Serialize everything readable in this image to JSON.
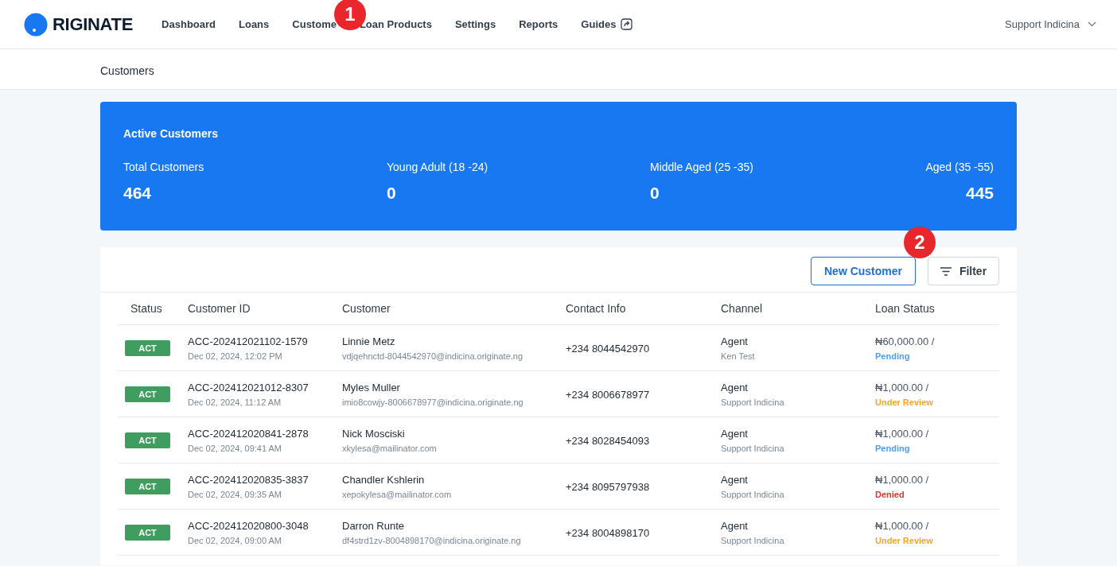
{
  "header": {
    "logo_text": "RIGINATE",
    "nav": [
      {
        "label": "Dashboard",
        "external": false
      },
      {
        "label": "Loans",
        "external": false
      },
      {
        "label": "Custome",
        "external": false
      },
      {
        "label": "Loan Products",
        "external": false
      },
      {
        "label": "Settings",
        "external": false
      },
      {
        "label": "Reports",
        "external": false
      },
      {
        "label": "Guides",
        "external": true
      }
    ],
    "user": "Support Indicina"
  },
  "breadcrumb": "Customers",
  "summary": {
    "title": "Active Customers",
    "stats": [
      {
        "label": "Total Customers",
        "value": "464"
      },
      {
        "label": "Young Adult (18 -24)",
        "value": "0"
      },
      {
        "label": "Middle Aged (25 -35)",
        "value": "0"
      },
      {
        "label": "Aged (35 -55)",
        "value": "445"
      }
    ]
  },
  "toolbar": {
    "new_button": "New Customer",
    "filter_button": "Filter"
  },
  "table": {
    "columns": [
      "Status",
      "Customer ID",
      "Customer",
      "Contact Info",
      "Channel",
      "Loan Status"
    ],
    "rows": [
      {
        "status": "ACT",
        "id": "ACC-202412021102-1579",
        "date": "Dec 02, 2024, 12:02 PM",
        "name": "Linnie Metz",
        "email": "vdjqehnctd-8044542970@indicina.originate.ng",
        "phone": "+234 8044542970",
        "channel": "Agent",
        "agent": "Ken Test",
        "amount": "₦60,000.00 /",
        "loan_status": "Pending",
        "color": "#4a9ff5"
      },
      {
        "status": "ACT",
        "id": "ACC-202412021012-8307",
        "date": "Dec 02, 2024, 11:12 AM",
        "name": "Myles Muller",
        "email": "imio8cowjy-8006678977@indicina.originate.ng",
        "phone": "+234 8006678977",
        "channel": "Agent",
        "agent": "Support Indicina",
        "amount": "₦1,000.00 /",
        "loan_status": "Under Review",
        "color": "#f5a623"
      },
      {
        "status": "ACT",
        "id": "ACC-202412020841-2878",
        "date": "Dec 02, 2024, 09:41 AM",
        "name": "Nick Mosciski",
        "email": "xkylesa@mailinator.com",
        "phone": "+234 8028454093",
        "channel": "Agent",
        "agent": "Support Indicina",
        "amount": "₦1,000.00 /",
        "loan_status": "Pending",
        "color": "#4a9ff5"
      },
      {
        "status": "ACT",
        "id": "ACC-202412020835-3837",
        "date": "Dec 02, 2024, 09:35 AM",
        "name": "Chandler Kshlerin",
        "email": "xepokylesa@mailinator.com",
        "phone": "+234 8095797938",
        "channel": "Agent",
        "agent": "Support Indicina",
        "amount": "₦1,000.00 /",
        "loan_status": "Denied",
        "color": "#e5322d"
      },
      {
        "status": "ACT",
        "id": "ACC-202412020800-3048",
        "date": "Dec 02, 2024, 09:00 AM",
        "name": "Darron Runte",
        "email": "df4strd1zv-8004898170@indicina.originate.ng",
        "phone": "+234 8004898170",
        "channel": "Agent",
        "agent": "Support Indicina",
        "amount": "₦1,000.00 /",
        "loan_status": "Under Review",
        "color": "#f5a623"
      }
    ]
  },
  "annotation_markers": [
    {
      "label": "1"
    },
    {
      "label": "2"
    }
  ]
}
